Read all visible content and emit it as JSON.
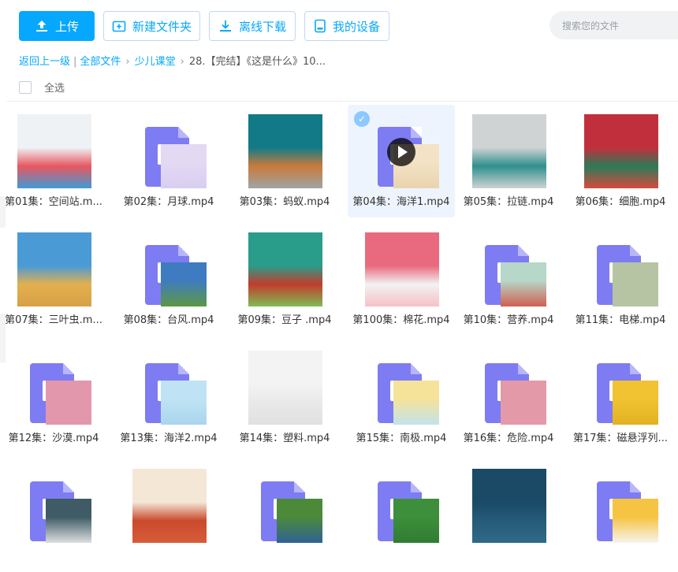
{
  "toolbar": {
    "upload_label": "上传",
    "new_folder_label": "新建文件夹",
    "offline_label": "离线下载",
    "devices_label": "我的设备",
    "search_placeholder": "搜索您的文件"
  },
  "breadcrumb": {
    "back": "返回上一级",
    "all_files": "全部文件",
    "folder": "少儿课堂",
    "current": "28.【完结】《这是什么》10..."
  },
  "select_all_label": "全选",
  "files": [
    {
      "name": "第01集：空间站.m...",
      "thumb": "photo",
      "colors": [
        "#eef2f5",
        "#e8575f",
        "#3f9bd6"
      ]
    },
    {
      "name": "第02集：月球.mp4",
      "thumb": "doc",
      "colors": [
        "#e3d9f3",
        "#d9cdef"
      ]
    },
    {
      "name": "第03集：蚂蚁.mp4",
      "thumb": "photo",
      "colors": [
        "#127a86",
        "#c97a3b",
        "#9fa4a6"
      ]
    },
    {
      "name": "第04集：海洋1.mp4",
      "thumb": "doc",
      "colors": [
        "#f3e2c5",
        "#e9d3ae"
      ],
      "selected": true,
      "video": true
    },
    {
      "name": "第05集：拉链.mp4",
      "thumb": "photo",
      "colors": [
        "#cfd3d4",
        "#2e8f8d",
        "#cfd3d4"
      ]
    },
    {
      "name": "第06集：细胞.mp4",
      "thumb": "photo",
      "colors": [
        "#c22f3c",
        "#2c7a57",
        "#d64a3f"
      ]
    },
    {
      "name": "第07集：三叶虫.m...",
      "thumb": "photo",
      "colors": [
        "#4a9ad6",
        "#e3b04e",
        "#d7a047"
      ]
    },
    {
      "name": "第08集：台风.mp4",
      "thumb": "doc",
      "colors": [
        "#3f7bc0",
        "#5d9a3b"
      ]
    },
    {
      "name": "第09集：豆子 .mp4",
      "thumb": "photo",
      "colors": [
        "#2a9c8a",
        "#c23c2c",
        "#7fbc55"
      ]
    },
    {
      "name": "第100集：棉花.mp4",
      "thumb": "photo",
      "colors": [
        "#e96a7e",
        "#f2f2f2",
        "#f6c0c6"
      ]
    },
    {
      "name": "第10集：营养.mp4",
      "thumb": "doc",
      "colors": [
        "#b7d7c8",
        "#d0584a"
      ]
    },
    {
      "name": "第11集：电梯.mp4",
      "thumb": "doc",
      "colors": [
        "#b6c4a3",
        "#b6c4a3"
      ]
    },
    {
      "name": "第12集：沙漠.mp4",
      "thumb": "doc",
      "colors": [
        "#e297ad",
        "#e297ad"
      ]
    },
    {
      "name": "第13集：海洋2.mp4",
      "thumb": "doc",
      "colors": [
        "#bfe3f4",
        "#a8d4ec"
      ]
    },
    {
      "name": "第14集：塑料.mp4",
      "thumb": "photo",
      "colors": [
        "#f3f3f3",
        "#e9e9e9",
        "#e0e0e0"
      ]
    },
    {
      "name": "第15集：南极.mp4",
      "thumb": "doc",
      "colors": [
        "#f5e39a",
        "#bfe3f0"
      ]
    },
    {
      "name": "第16集：危险.mp4",
      "thumb": "doc",
      "colors": [
        "#e499a8",
        "#e499a8"
      ]
    },
    {
      "name": "第17集：磁悬浮列...",
      "thumb": "doc",
      "colors": [
        "#f1c232",
        "#e1b121"
      ]
    },
    {
      "name": "",
      "thumb": "doc",
      "colors": [
        "#3e5b66",
        "#e6e6e6"
      ]
    },
    {
      "name": "",
      "thumb": "photo",
      "colors": [
        "#f4e7d6",
        "#c94a2c",
        "#d85c39"
      ]
    },
    {
      "name": "",
      "thumb": "doc",
      "colors": [
        "#4c8a3a",
        "#2d5f9b"
      ]
    },
    {
      "name": "",
      "thumb": "doc",
      "colors": [
        "#3d8f3b",
        "#2f7c31"
      ]
    },
    {
      "name": "",
      "thumb": "photo",
      "colors": [
        "#1a4a66",
        "#255b78",
        "#2e6a87"
      ]
    },
    {
      "name": "",
      "thumb": "doc",
      "colors": [
        "#f6c443",
        "#f7f7f7"
      ]
    }
  ]
}
